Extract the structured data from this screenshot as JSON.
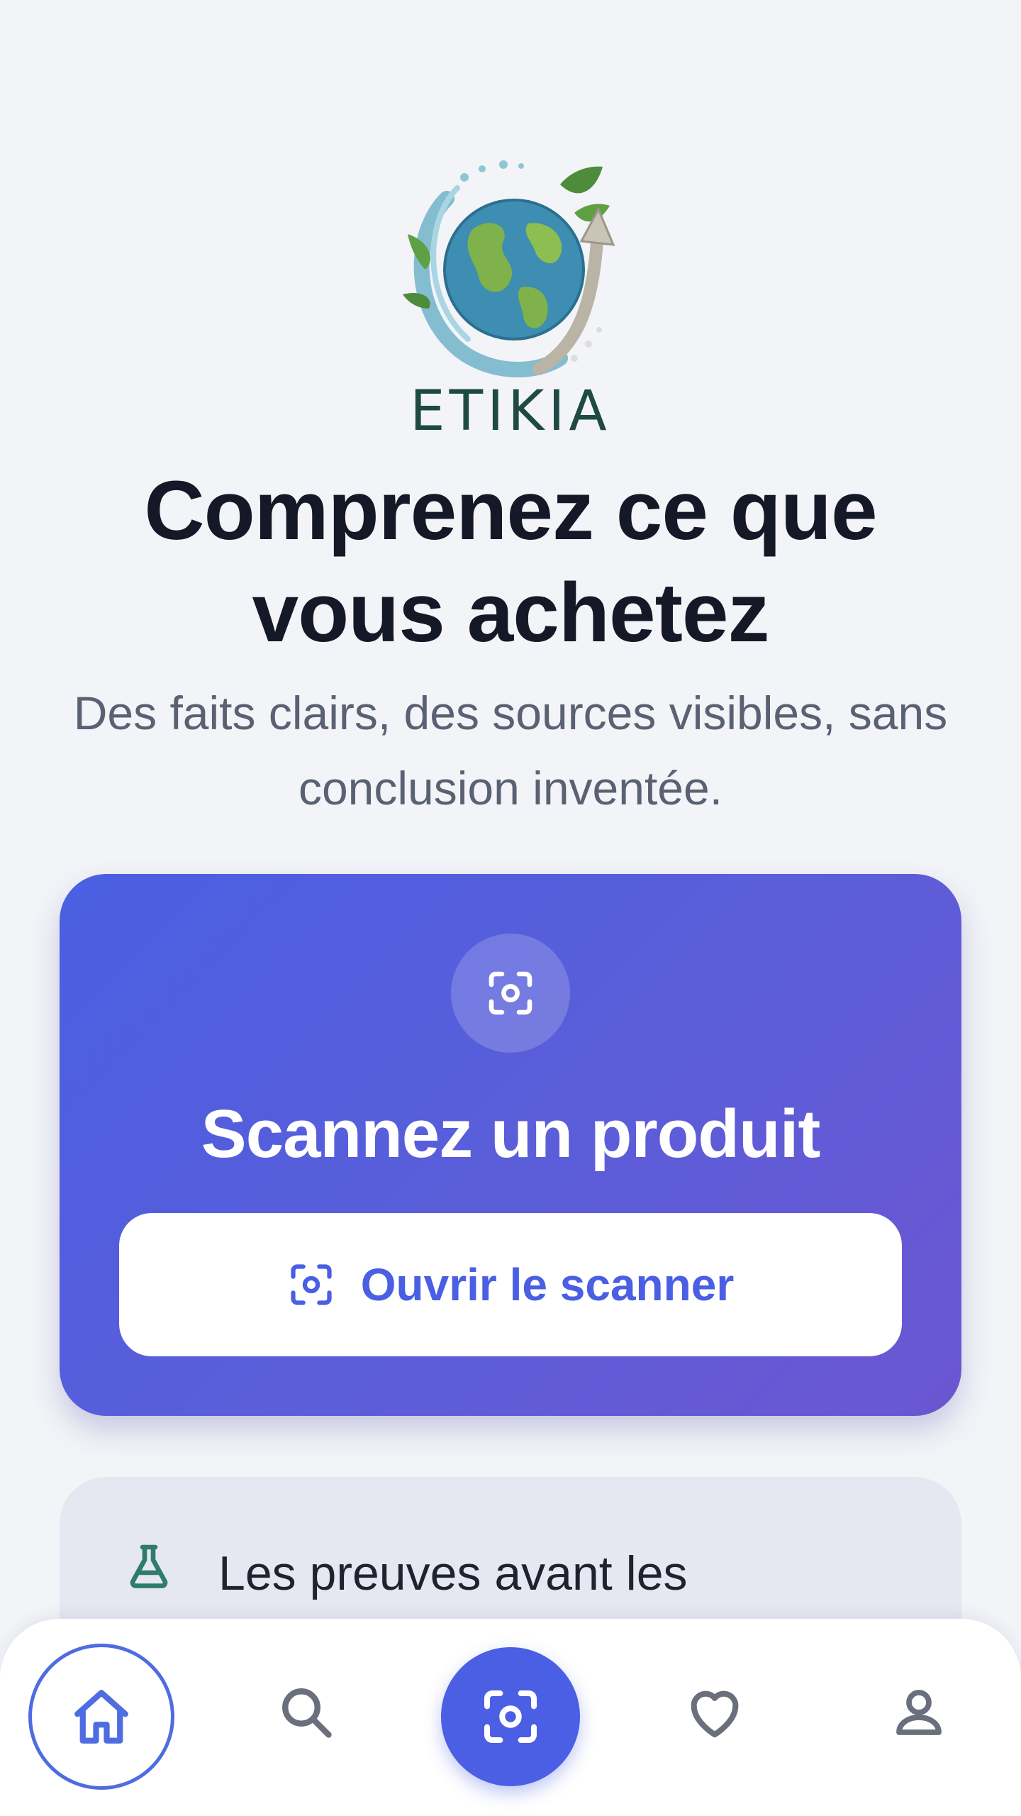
{
  "brand": {
    "name": "ETIKIA"
  },
  "hero": {
    "title": "Comprenez ce que vous achetez",
    "subtitle": "Des faits clairs, des sources visibles, sans conclusion inventée."
  },
  "scan_card": {
    "icon": "scan-icon",
    "title": "Scannez un produit",
    "button_label": "Ouvrir le scanner",
    "button_icon": "scan-icon"
  },
  "info_card": {
    "icon": "flask-icon",
    "text": "Les preuves avant les conclusions"
  },
  "bottom_nav": {
    "items": [
      {
        "icon": "home-icon",
        "active": true
      },
      {
        "icon": "search-icon",
        "active": false
      },
      {
        "icon": "scan-icon",
        "active": false
      },
      {
        "icon": "heart-icon",
        "active": false
      },
      {
        "icon": "profile-icon",
        "active": false
      }
    ]
  },
  "colors": {
    "background": "#F3F4F8",
    "accent": "#4A5FE3",
    "accent_end": "#6C56D2",
    "title": "#141827",
    "subtitle": "#5A6172",
    "brand_text": "#1F4A44",
    "info_icon": "#2E7D6B"
  }
}
